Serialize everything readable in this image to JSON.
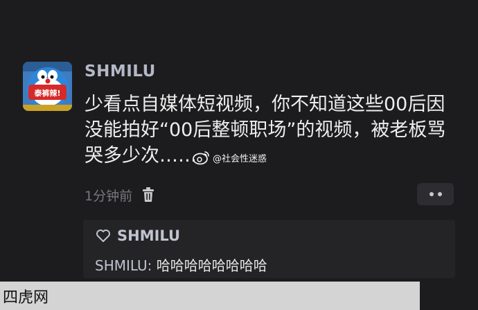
{
  "post": {
    "username": "SHMILU",
    "avatar_text": "泰裤辣!",
    "content": "少看点自媒体短视频，你不知道这些00后因没能拍好“00后整顿职场”的视频，被老板骂哭多少次……",
    "watermark": "@社会性迷惑",
    "time": "1分钟前"
  },
  "reply": {
    "like_user": "SHMILU",
    "author": "SHMILU:",
    "text": " 哈哈哈哈哈哈哈哈"
  },
  "site_watermark": "四虎网",
  "icons": {
    "trash": "trash-icon",
    "more": "more-icon",
    "heart": "heart-icon",
    "weibo": "weibo-logo-icon"
  }
}
